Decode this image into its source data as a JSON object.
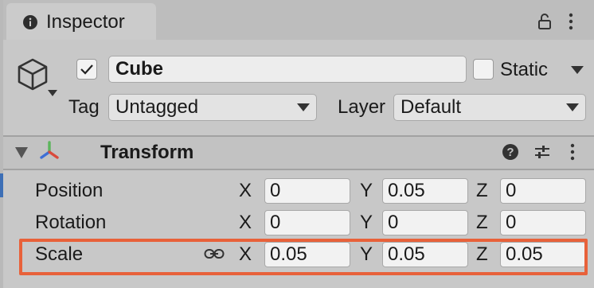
{
  "window": {
    "tab_label": "Inspector",
    "icons": [
      "info-icon",
      "lock-icon",
      "kebab-menu-icon"
    ]
  },
  "gameobject": {
    "enabled": true,
    "name": "Cube",
    "static_label": "Static",
    "static_checked": false,
    "tag_label": "Tag",
    "tag_value": "Untagged",
    "layer_label": "Layer",
    "layer_value": "Default"
  },
  "transform": {
    "title": "Transform",
    "rows": [
      {
        "label": "Position",
        "x": "0",
        "y": "0.05",
        "z": "0"
      },
      {
        "label": "Rotation",
        "x": "0",
        "y": "0",
        "z": "0"
      },
      {
        "label": "Scale",
        "x": "0.05",
        "y": "0.05",
        "z": "0.05"
      }
    ],
    "axis_labels": {
      "x": "X",
      "y": "Y",
      "z": "Z"
    }
  },
  "colors": {
    "highlight": "#e8613a",
    "axis_x": "#d94a3c",
    "axis_y": "#5bb55b",
    "axis_z": "#3d6fd6"
  }
}
